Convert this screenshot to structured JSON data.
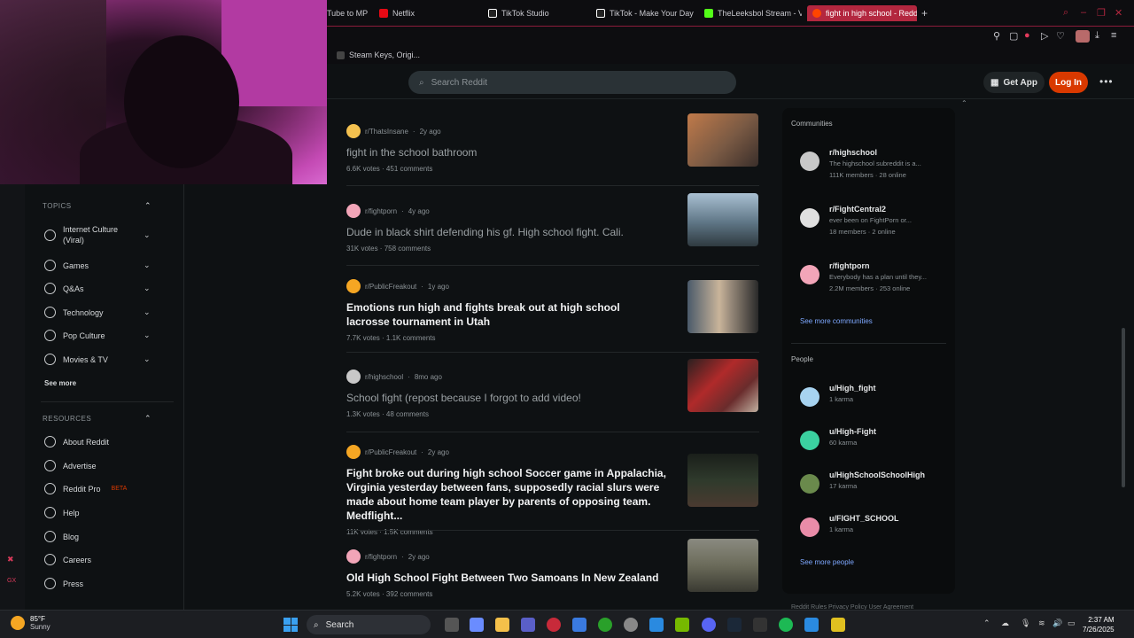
{
  "browser": {
    "tabs": [
      {
        "label": "Tube to MP",
        "color": "#c9c9cf"
      },
      {
        "label": "Netflix",
        "color": "#e50914"
      },
      {
        "label": "TikTok Studio",
        "color": "#ffffff"
      },
      {
        "label": "TikTok - Make Your Day",
        "color": "#ffffff"
      },
      {
        "label": "TheLeeksbol Stream - V",
        "color": "#53fc18"
      },
      {
        "label": "fight in high school - Redd",
        "color": "#ff4500"
      }
    ],
    "new_tab_label": "+",
    "bookmark_label": "Steam Keys, Origi..."
  },
  "reddit": {
    "search_placeholder": "Search Reddit",
    "get_app_label": "Get App",
    "login_label": "Log In",
    "more_label": "•••"
  },
  "sidebar": {
    "topics_header": "TOPICS",
    "topics": [
      {
        "label": "Internet Culture (Viral)",
        "icon": "smile-icon"
      },
      {
        "label": "Games",
        "icon": "gamepad-icon"
      },
      {
        "label": "Q&As",
        "icon": "question-bubble-icon"
      },
      {
        "label": "Technology",
        "icon": "chip-icon"
      },
      {
        "label": "Pop Culture",
        "icon": "star-icon"
      },
      {
        "label": "Movies & TV",
        "icon": "clapper-icon"
      }
    ],
    "see_more": "See more",
    "resources_header": "RESOURCES",
    "resources": [
      {
        "label": "About Reddit",
        "icon": "reddit-icon"
      },
      {
        "label": "Advertise",
        "icon": "megaphone-icon"
      },
      {
        "label": "Reddit Pro",
        "icon": "chart-icon",
        "badge": "BETA"
      },
      {
        "label": "Help",
        "icon": "help-icon"
      },
      {
        "label": "Blog",
        "icon": "book-icon"
      },
      {
        "label": "Careers",
        "icon": "wrench-icon"
      },
      {
        "label": "Press",
        "icon": "pen-icon"
      }
    ]
  },
  "posts": [
    {
      "sub": "r/ThatsInsane",
      "age": "2y ago",
      "title": "fight in the school bathroom",
      "votes": "6.6K votes",
      "comments": "451 comments",
      "style": "visited",
      "avatar": "#f4c14f",
      "thumb": "#7a5a44"
    },
    {
      "sub": "r/fightporn",
      "age": "4y ago",
      "title": "Dude in black shirt defending his gf. High school fight. Cali.",
      "votes": "31K votes",
      "comments": "758 comments",
      "style": "visited",
      "avatar": "#f2a5b8",
      "thumb": "#5f7686"
    },
    {
      "sub": "r/PublicFreakout",
      "age": "1y ago",
      "title": "Emotions run high and fights break out at high school lacrosse tournament in Utah",
      "votes": "7.7K votes",
      "comments": "1.1K comments",
      "style": "bold",
      "avatar": "#f5a623",
      "thumb": "#9a8c7c"
    },
    {
      "sub": "r/highschool",
      "age": "8mo ago",
      "title": "School fight (repost because I forgot to add video!",
      "votes": "1.3K votes",
      "comments": "48 comments",
      "style": "visited",
      "avatar": "#c8c8c8",
      "thumb": "#6a2c2c"
    },
    {
      "sub": "r/PublicFreakout",
      "age": "2y ago",
      "title": "Fight broke out during high school Soccer game in Appalachia, Virginia yesterday between fans, supposedly racial slurs were made about home team player by parents of opposing team. Medflight...",
      "votes": "11K votes",
      "comments": "1.5K comments",
      "style": "bold",
      "avatar": "#f5a623",
      "thumb": "#2f3a2c"
    },
    {
      "sub": "r/fightporn",
      "age": "2y ago",
      "title": "Old High School Fight Between Two Samoans In New Zealand",
      "votes": "5.2K votes",
      "comments": "392 comments",
      "style": "bold",
      "avatar": "#f2a5b8",
      "thumb": "#6b6b5a"
    }
  ],
  "right_panel": {
    "communities_header": "Communities",
    "communities": [
      {
        "name": "r/highschool",
        "desc": "The highschool subreddit is a...",
        "members": "111K members",
        "online": "28 online",
        "avatar": "#c8c8c8"
      },
      {
        "name": "r/FightCentral2",
        "desc": "ever been on FightPorn or...",
        "members": "18 members",
        "online": "2 online",
        "avatar": "#e0e0e0"
      },
      {
        "name": "r/fightporn",
        "desc": "Everybody has a plan until they...",
        "members": "2.2M members",
        "online": "253 online",
        "avatar": "#f2a5b8"
      }
    ],
    "see_more_communities": "See more communities",
    "people_header": "People",
    "people": [
      {
        "name": "u/High_fight",
        "karma": "1 karma",
        "avatar": "#a7d3f0"
      },
      {
        "name": "u/High-Fight",
        "karma": "60 karma",
        "avatar": "#3bd1a0"
      },
      {
        "name": "u/HighSchoolSchoolHigh",
        "karma": "17 karma",
        "avatar": "#6a8a4c"
      },
      {
        "name": "u/FIGHT_SCHOOL",
        "karma": "1 karma",
        "avatar": "#e98ca8"
      }
    ],
    "see_more_people": "See more people",
    "footer": "Reddit Rules  Privacy Policy  User Agreement"
  },
  "taskbar": {
    "temp": "85°F",
    "weather": "Sunny",
    "search_label": "Search",
    "time": "2:37 AM",
    "date": "7/26/2025"
  }
}
